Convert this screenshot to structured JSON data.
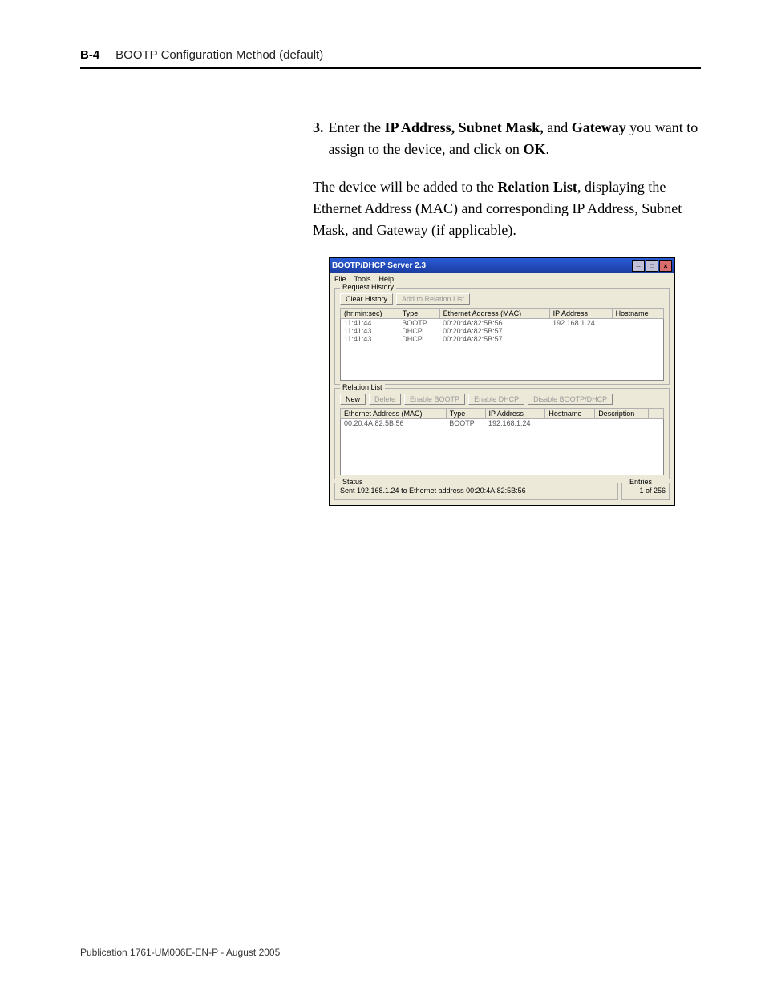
{
  "header": {
    "page_number": "B-4",
    "title": "BOOTP Configuration Method (default)"
  },
  "body": {
    "step_number": "3.",
    "step_sentence_prefix": "Enter the ",
    "bold1": "IP Address, Subnet Mask,",
    "mid1": " and ",
    "bold2": "Gateway",
    "mid2": " you want to assign to the device, and click on ",
    "bold3": "OK",
    "end1": ".",
    "para2_prefix": "The device will be added to the ",
    "para2_bold": "Relation List",
    "para2_suffix": ", displaying the Ethernet Address (MAC) and corresponding IP Address, Subnet Mask, and Gateway (if applicable)."
  },
  "window": {
    "title": "BOOTP/DHCP Server 2.3",
    "menu": {
      "file": "File",
      "tools": "Tools",
      "help": "Help"
    },
    "request_history": {
      "title": "Request History",
      "clear_button": "Clear History",
      "add_button": "Add to Relation List",
      "columns": {
        "time": "(hr:min:sec)",
        "type": "Type",
        "mac": "Ethernet Address (MAC)",
        "ip": "IP Address",
        "host": "Hostname"
      },
      "rows": [
        {
          "time": "11:41:44",
          "type": "BOOTP",
          "mac": "00:20:4A:82:5B:56",
          "ip": "192.168.1.24",
          "host": ""
        },
        {
          "time": "11:41:43",
          "type": "DHCP",
          "mac": "00:20:4A:82:5B:57",
          "ip": "",
          "host": ""
        },
        {
          "time": "11:41:43",
          "type": "DHCP",
          "mac": "00:20:4A:82:5B:57",
          "ip": "",
          "host": ""
        }
      ]
    },
    "relation_list": {
      "title": "Relation List",
      "buttons": {
        "new": "New",
        "delete": "Delete",
        "enable_bootp": "Enable BOOTP",
        "enable_dhcp": "Enable DHCP",
        "disable": "Disable BOOTP/DHCP"
      },
      "columns": {
        "mac": "Ethernet Address (MAC)",
        "type": "Type",
        "ip": "IP Address",
        "host": "Hostname",
        "desc": "Description"
      },
      "rows": [
        {
          "mac": "00:20:4A:82:5B:56",
          "type": "BOOTP",
          "ip": "192.168.1.24",
          "host": "",
          "desc": ""
        }
      ]
    },
    "status": {
      "title": "Status",
      "text": "Sent 192.168.1.24 to Ethernet address 00:20:4A:82:5B:56"
    },
    "entries": {
      "title": "Entries",
      "text": "1 of 256"
    }
  },
  "footer": "Publication 1761-UM006E-EN-P - August 2005"
}
